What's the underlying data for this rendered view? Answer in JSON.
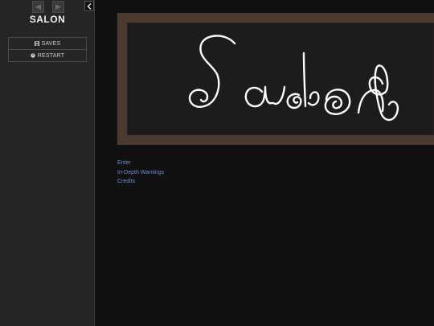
{
  "sidebar": {
    "title": "SALON",
    "history": {
      "back_icon": "arrow-left-icon",
      "forward_icon": "arrow-right-icon"
    },
    "stow_icon": "chevron-left-icon",
    "menu": [
      {
        "label": "SAVES",
        "icon": "save-icon"
      },
      {
        "label": "RESTART",
        "icon": "power-icon"
      }
    ]
  },
  "passage": {
    "banner_text": "Salon",
    "links": [
      {
        "label": "Enter"
      },
      {
        "label": "In-Depth Warnings"
      },
      {
        "label": "Credits"
      }
    ]
  },
  "colors": {
    "sidebar_bg": "#252525",
    "page_bg": "#111111",
    "link": "#6b8fd0",
    "board_frame": "#4a3a30",
    "board_bg": "#1c1c1c"
  }
}
